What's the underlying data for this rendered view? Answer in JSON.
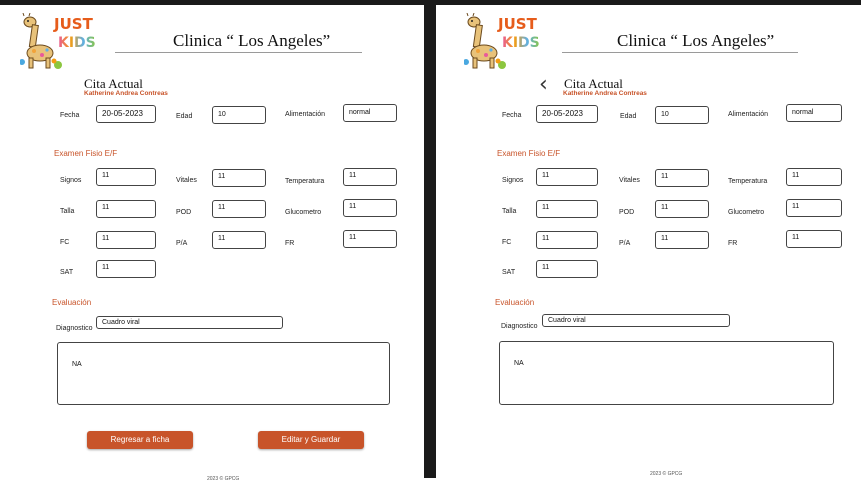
{
  "brand": {
    "line1": "JUST",
    "line2": "KIDS"
  },
  "header": {
    "title": "Clinica “ Los Angeles”"
  },
  "appointment": {
    "heading": "Cita Actual",
    "patient": "Katherine Andrea Contreas"
  },
  "fields": {
    "fecha": {
      "label": "Fecha",
      "value": "20-05-2023"
    },
    "edad": {
      "label": "Edad",
      "value": "10"
    },
    "alimentacion": {
      "label": "Alimentación",
      "value": "normal"
    }
  },
  "exam": {
    "title": "Examen Fisio E/F",
    "signos": {
      "label": "Signos",
      "value": "11"
    },
    "vitales": {
      "label": "Vitales",
      "value": "11"
    },
    "temperatura": {
      "label": "Temperatura",
      "value": "11"
    },
    "talla": {
      "label": "Talla",
      "value": "11"
    },
    "pod": {
      "label": "POD",
      "value": "11"
    },
    "glucometro": {
      "label": "Glucometro",
      "value": "11"
    },
    "fc": {
      "label": "FC",
      "value": "11"
    },
    "pa": {
      "label": "P/A",
      "value": "11"
    },
    "fr": {
      "label": "FR",
      "value": "11"
    },
    "sat": {
      "label": "SAT",
      "value": "11"
    }
  },
  "evaluation": {
    "title": "Evaluación",
    "diagnostico_label": "Diagnostico",
    "diagnostico_value": "Cuadro viral",
    "notes": "NA"
  },
  "actions": {
    "back": "Regresar a ficha",
    "save": "Editar y Guardar"
  },
  "footer": "2023 © GPCG",
  "colors": {
    "accent": "#c8542a",
    "frame": "#1a1a1a"
  }
}
